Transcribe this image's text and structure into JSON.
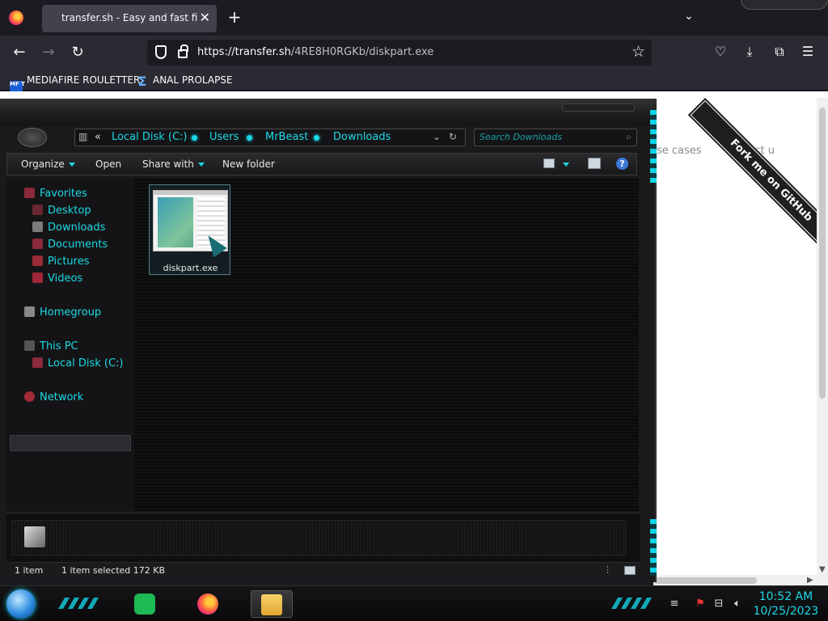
{
  "browser": {
    "tab_title": "transfer.sh - Easy and fast file sharing from the command-line.",
    "tab_close": "✕",
    "new_tab": "+",
    "tab_list": "⌄",
    "url_host": "https://transfer.sh",
    "url_path": "/4RE8H0RGKb/diskpart.exe",
    "back": "←",
    "forward": "→",
    "reload": "↻",
    "star": "☆",
    "download": "⤓",
    "pocket": "♡",
    "extensions": "⧉",
    "menu": "☰",
    "bookmarks": [
      {
        "label": "MEDIAFIRE ROULETTER",
        "icon": "mediafire-icon"
      },
      {
        "label": "ANAL PROLAPSE",
        "icon": "sigma-icon"
      }
    ],
    "mf_icon_text": "MF T",
    "sigma_glyph": "Σ"
  },
  "webpage": {
    "nav_use_cases": "se cases",
    "nav_contact": "contact u",
    "ribbon": "Fork me on GitHub"
  },
  "explorer": {
    "breadcrumb": [
      "Local Disk (C:)",
      "Users",
      "MrBeast",
      "Downloads"
    ],
    "breadcrumb_prefix": "«",
    "search_placeholder": "Search Downloads",
    "toolbar": {
      "organize": "Organize",
      "open": "Open",
      "share_with": "Share with",
      "new_folder": "New folder",
      "help": "?"
    },
    "nav": {
      "favorites": "Favorites",
      "desktop": "Desktop",
      "downloads": "Downloads",
      "documents": "Documents",
      "pictures": "Pictures",
      "videos": "Videos",
      "homegroup": "Homegroup",
      "this_pc": "This PC",
      "local_disk": "Local Disk (C:)",
      "network": "Network"
    },
    "file": {
      "name": "diskpart.exe"
    },
    "status": {
      "item_count": "1 item",
      "selected": "1 item selected  172 KB"
    }
  },
  "taskbar": {
    "time": "10:52 AM",
    "date": "10/25/2023"
  },
  "colors": {
    "accent": "#1bd9e6",
    "background": "#1a1a1c"
  }
}
